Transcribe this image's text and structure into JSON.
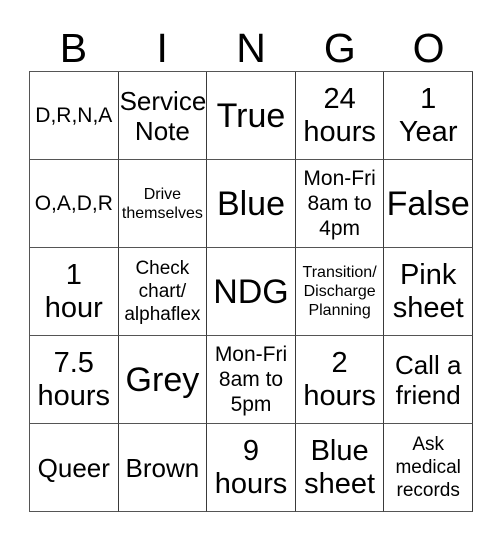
{
  "card": {
    "headers": [
      "B",
      "I",
      "N",
      "G",
      "O"
    ],
    "rows": [
      [
        {
          "text": "D,R,N,A",
          "size": "size-s"
        },
        {
          "text": "Service\nNote",
          "size": "size-m"
        },
        {
          "text": "True",
          "size": "size-xl"
        },
        {
          "text": "24\nhours",
          "size": "size-l"
        },
        {
          "text": "1\nYear",
          "size": "size-l"
        }
      ],
      [
        {
          "text": "O,A,D,R",
          "size": "size-s"
        },
        {
          "text": "Drive\nthemselves",
          "size": "size-xxs"
        },
        {
          "text": "Blue",
          "size": "size-xl"
        },
        {
          "text": "Mon-Fri\n8am to\n4pm",
          "size": "size-s"
        },
        {
          "text": "False",
          "size": "size-xl"
        }
      ],
      [
        {
          "text": "1\nhour",
          "size": "size-l"
        },
        {
          "text": "Check\nchart/\nalphaflex",
          "size": "size-xs"
        },
        {
          "text": "NDG",
          "size": "size-xl"
        },
        {
          "text": "Transition/\nDischarge\nPlanning",
          "size": "size-xxs"
        },
        {
          "text": "Pink\nsheet",
          "size": "size-l"
        }
      ],
      [
        {
          "text": "7.5\nhours",
          "size": "size-l"
        },
        {
          "text": "Grey",
          "size": "size-xl"
        },
        {
          "text": "Mon-Fri\n8am to\n5pm",
          "size": "size-s"
        },
        {
          "text": "2\nhours",
          "size": "size-l"
        },
        {
          "text": "Call a\nfriend",
          "size": "size-m"
        }
      ],
      [
        {
          "text": "Queer",
          "size": "size-m"
        },
        {
          "text": "Brown",
          "size": "size-m"
        },
        {
          "text": "9\nhours",
          "size": "size-l"
        },
        {
          "text": "Blue\nsheet",
          "size": "size-l"
        },
        {
          "text": "Ask\nmedical\nrecords",
          "size": "size-xs"
        }
      ]
    ]
  },
  "colors": {
    "background": "#ffffff",
    "text": "#000000",
    "grid_line": "#555555"
  }
}
